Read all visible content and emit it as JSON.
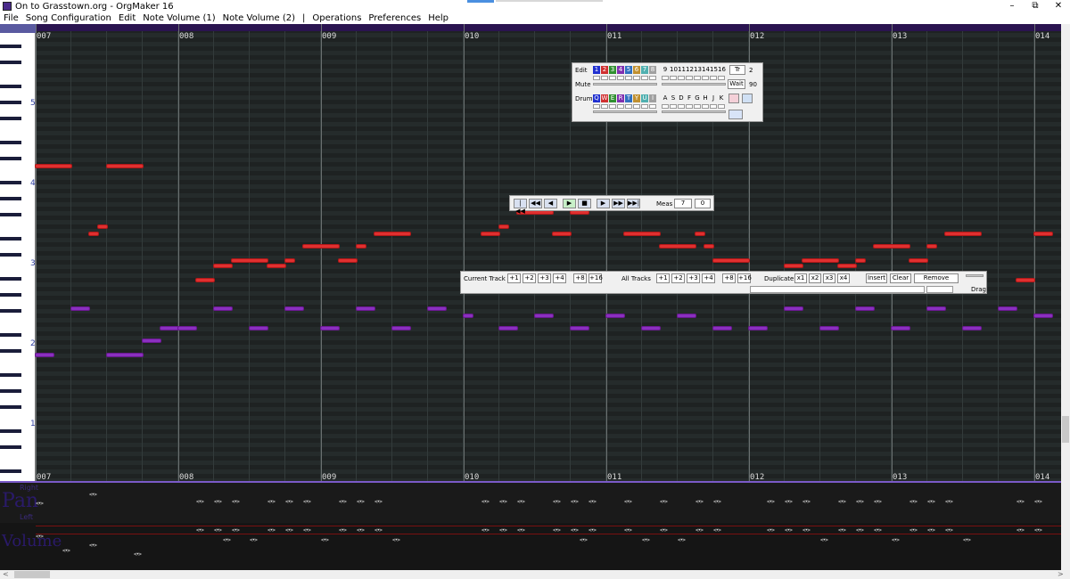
{
  "window": {
    "title": "On to Grasstown.org - OrgMaker 16",
    "minimize": "–",
    "restore": "⧉",
    "close": "✕"
  },
  "menu": [
    "File",
    "Song Configuration",
    "Edit",
    "Note Volume (1)",
    "Note Volume (2)",
    "|",
    "Operations",
    "Preferences",
    "Help"
  ],
  "measures": [
    "007",
    "008",
    "009",
    "010",
    "011",
    "012",
    "013",
    "014"
  ],
  "octaves": [
    "5",
    "4",
    "3",
    "2",
    "1"
  ],
  "track_panel": {
    "edit_label": "Edit",
    "mute_label": "Mute",
    "drum_label": "Drum",
    "melody_tracks": [
      "1",
      "2",
      "3",
      "4",
      "5",
      "6",
      "7",
      "8"
    ],
    "melody_colors": [
      "#2030d0",
      "#d03030",
      "#309030",
      "#8030b0",
      "#3070c0",
      "#c09030",
      "#50b0b0",
      "#a0a0a0"
    ],
    "drum_tracks": [
      "Q",
      "W",
      "E",
      "R",
      "T",
      "Y",
      "U",
      "I"
    ],
    "drum_colors": [
      "#2030d0",
      "#d03030",
      "#309030",
      "#8030b0",
      "#3070c0",
      "#c09030",
      "#50b0b0",
      "#a0a0a0"
    ],
    "numbers_top": [
      "9",
      "10",
      "11",
      "12",
      "13",
      "14",
      "15",
      "16"
    ],
    "letters_bottom": [
      "A",
      "S",
      "D",
      "F",
      "G",
      "H",
      "J",
      "K"
    ],
    "tr_label": "Tr",
    "tr_value": "2",
    "wait_label": "Wait",
    "wait_value": "90"
  },
  "playback": {
    "buttons": [
      "|◀◀",
      "◀◀",
      "◀",
      "▶",
      "■",
      "▶",
      "▶▶",
      "▶▶|"
    ],
    "meas_label": "Meas",
    "meas_value": "7",
    "beat_value": "0"
  },
  "shift_panel": {
    "current_track_label": "Current Track",
    "current_buttons": [
      "+1",
      "+2",
      "+3",
      "+4",
      "+8",
      "+16"
    ],
    "all_tracks_label": "All Tracks",
    "all_buttons": [
      "+1",
      "+2",
      "+3",
      "+4",
      "+8",
      "+16"
    ],
    "duplicate_label": "Duplicate",
    "dup_buttons": [
      "x1",
      "x2",
      "x3",
      "x4"
    ],
    "insert": "Insert",
    "clear": "Clear",
    "remove": "Remove",
    "drag": "Drag"
  },
  "bottom_labels": {
    "pan": "Pan",
    "volume": "Volume",
    "right": "Right",
    "left": "Left"
  },
  "arrow_glyph": "<•>"
}
